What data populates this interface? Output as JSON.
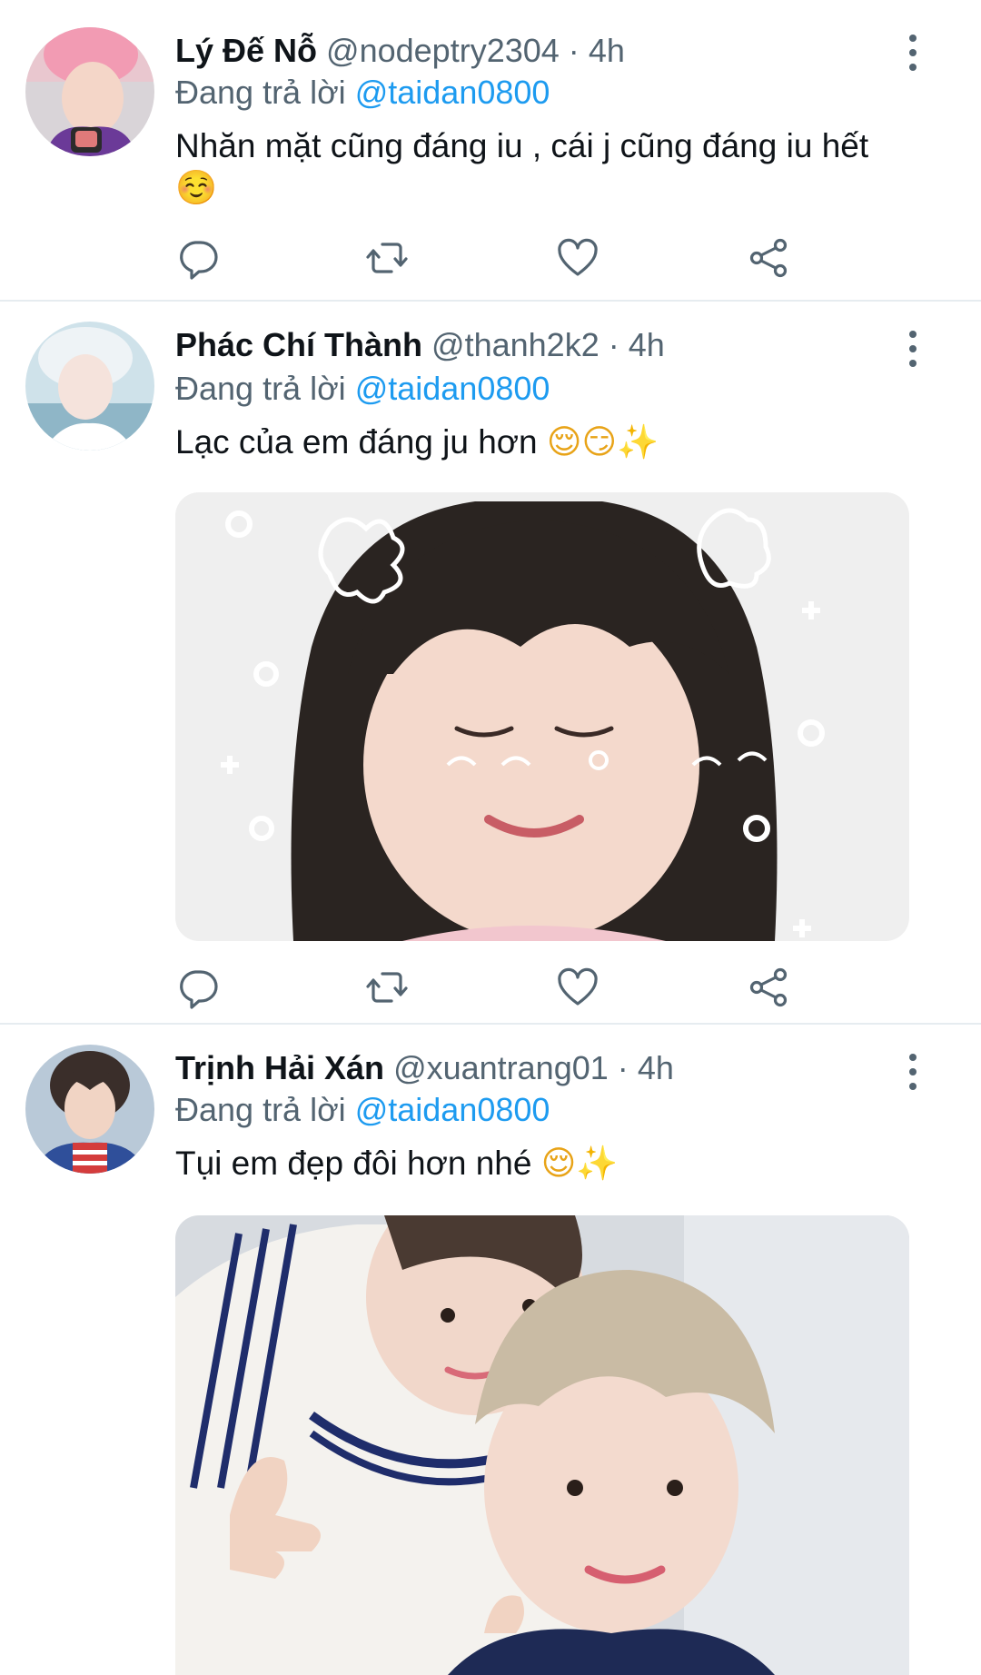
{
  "tweets": [
    {
      "name": "Lý Đế Nỗ",
      "handle": "@nodeptry2304",
      "sep": "·",
      "time": "4h",
      "reply_prefix": "Đang trả lời",
      "reply_to": "@taidan0800",
      "text_line1": "Nhăn mặt cũng đáng iu , cái j cũng đáng iu hết",
      "emoji_line2": "☺️"
    },
    {
      "name": "Phác Chí Thành",
      "handle": "@thanh2k2",
      "sep": "·",
      "time": "4h",
      "reply_prefix": "Đang trả lời",
      "reply_to": "@taidan0800",
      "text": "Lạc của em đáng ju hơn",
      "emoji": "😌😏✨"
    },
    {
      "name": "Trịnh Hải Xán",
      "handle": "@xuantrang01",
      "sep": "·",
      "time": "4h",
      "reply_prefix": "Đang trả lời",
      "reply_to": "@taidan0800",
      "text": "Tụi em đẹp đôi hơn nhé",
      "emoji": "😌✨"
    }
  ],
  "icons": {
    "reply": "comment-icon",
    "retweet": "retweet-icon",
    "like": "heart-icon",
    "share": "share-icon",
    "more": "more-vertical-icon"
  },
  "colors": {
    "text": "#0f1419",
    "secondary": "#536471",
    "mention": "#1d9bf0",
    "divider": "#e6ecf0"
  }
}
